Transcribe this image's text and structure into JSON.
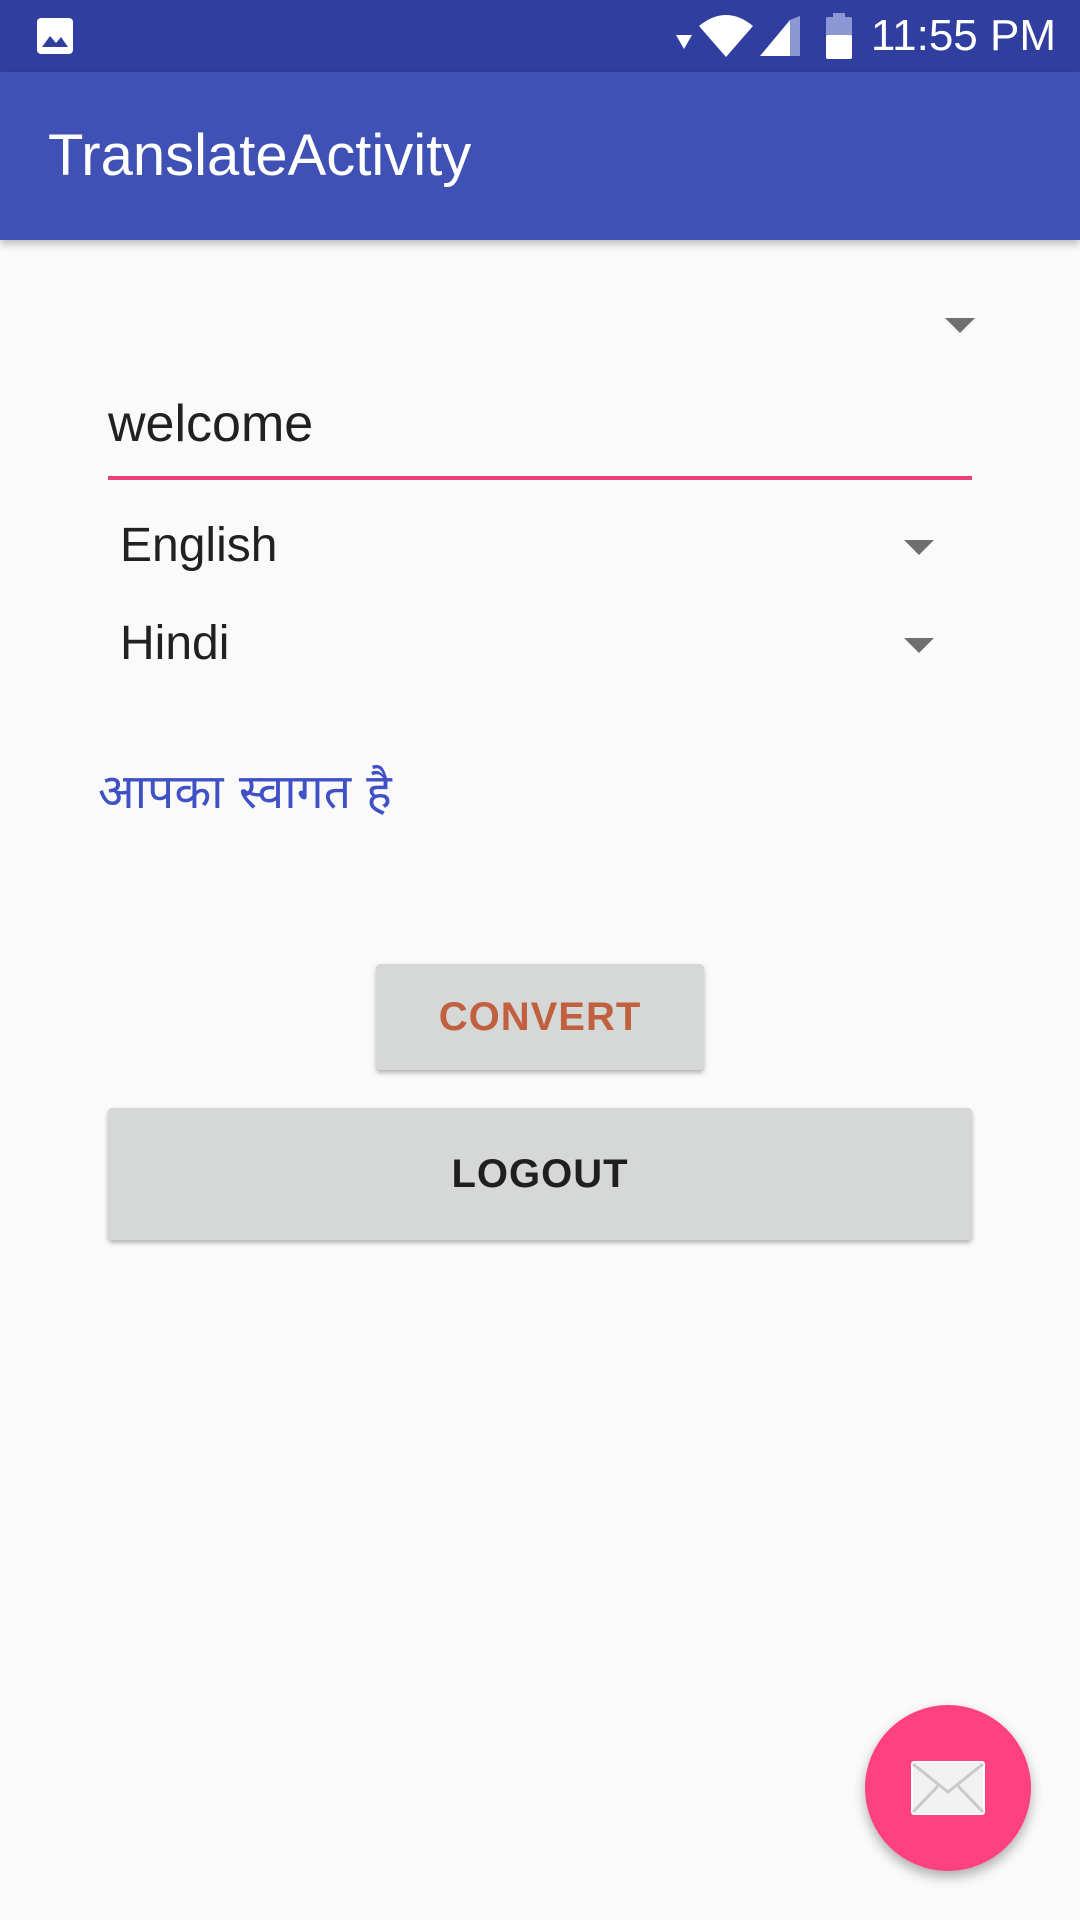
{
  "status_bar": {
    "time": "11:55 PM",
    "icons": [
      "gallery-icon",
      "download-icon",
      "wifi-icon",
      "signal-icon",
      "battery-icon"
    ]
  },
  "app_bar": {
    "title": "TranslateActivity"
  },
  "input": {
    "value": "welcome"
  },
  "source_language": {
    "selected": "English"
  },
  "target_language": {
    "selected": "Hindi"
  },
  "result": {
    "text": "आपका स्वागत है"
  },
  "buttons": {
    "convert": "CONVERT",
    "logout": "LOGOUT"
  },
  "fab": {
    "icon": "mail-icon"
  },
  "colors": {
    "status_bar": "#303f9f",
    "app_bar": "#3f51b5",
    "accent": "#ff4081",
    "input_underline": "#ec407a",
    "result_text": "#3f51c5",
    "convert_text": "#c0603f",
    "button_bg": "#d6d7d7"
  }
}
